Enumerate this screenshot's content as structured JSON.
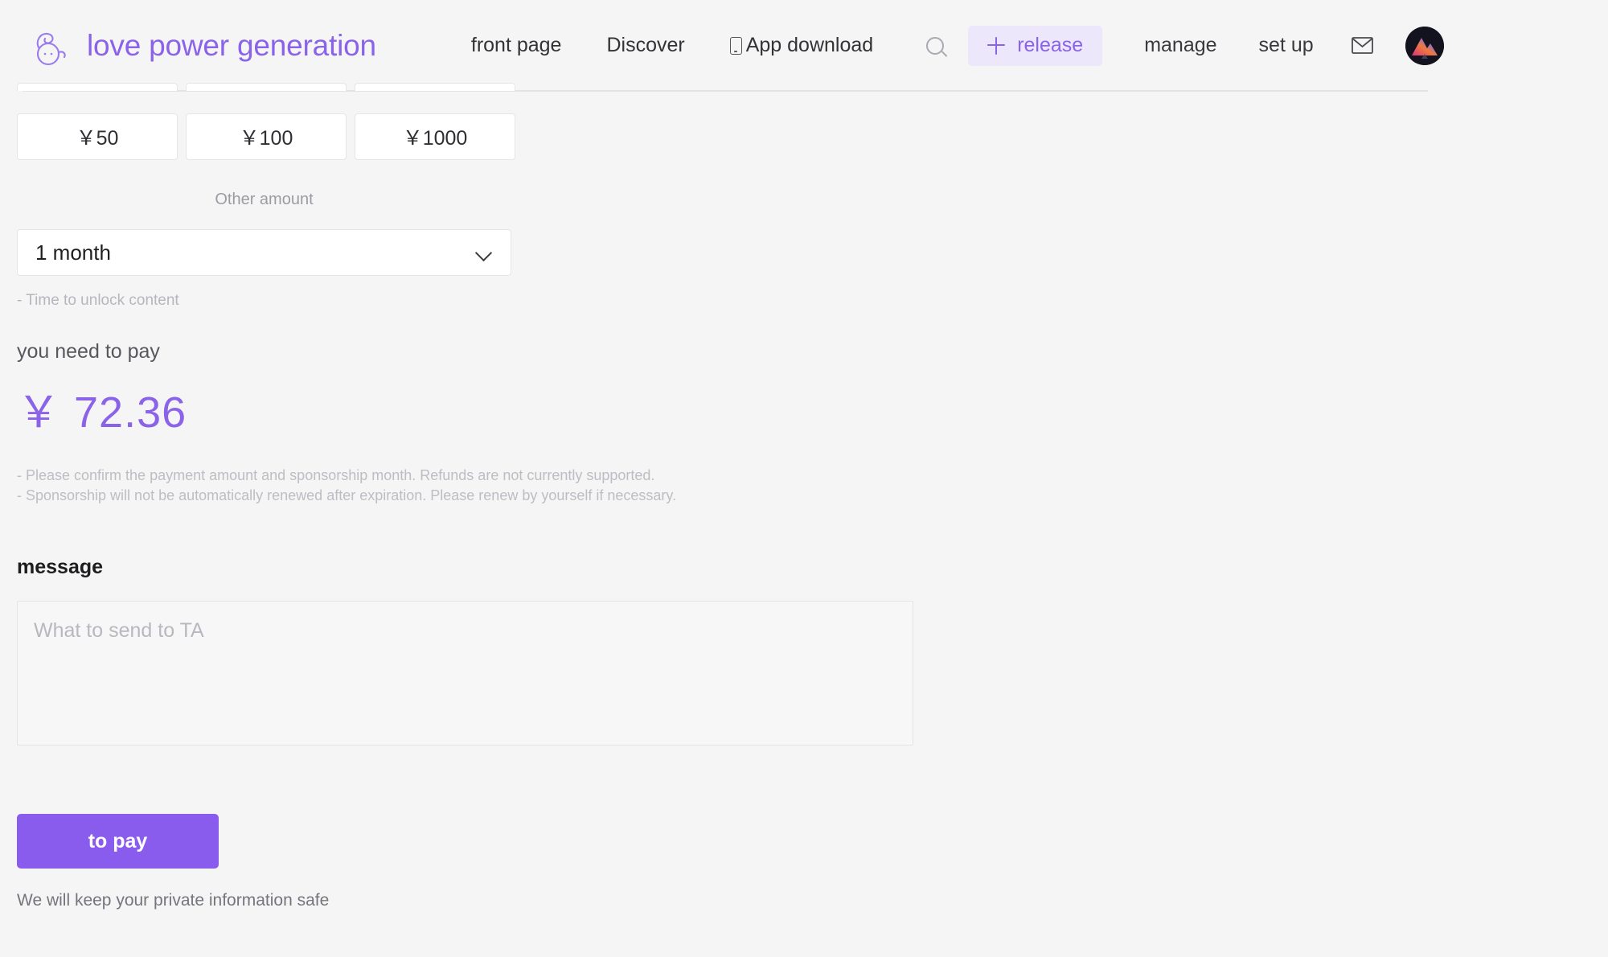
{
  "header": {
    "brand_name": "love power generation",
    "logo_icon": "snail-logo-icon",
    "nav": [
      {
        "label": "front page",
        "icon": null
      },
      {
        "label": "Discover",
        "icon": null
      },
      {
        "label": "App download",
        "icon": "phone-icon"
      }
    ],
    "search_icon": "search-icon",
    "release_label": "release",
    "release_icon": "plus-icon",
    "nav_right": [
      {
        "label": "manage"
      },
      {
        "label": "set up"
      }
    ],
    "mail_icon": "mail-icon",
    "avatar_icon": "user-avatar"
  },
  "sponsor_form": {
    "amount_options": [
      "￥50",
      "￥100",
      "￥1000"
    ],
    "other_amount_placeholder": "Other amount",
    "duration_selected": "1 month",
    "duration_hint": "- Time to unlock content",
    "pay_label": "you need to pay",
    "pay_amount": "￥ 72.36",
    "notes": [
      "- Please confirm the payment amount and sponsorship month. Refunds are not currently supported.",
      "- Sponsorship will not be automatically renewed after expiration. Please renew by yourself if necessary."
    ],
    "message_title": "message",
    "message_placeholder": "What to send to TA",
    "submit_label": "to pay",
    "privacy_note": "We will keep your private information safe"
  },
  "colors": {
    "accent": "#8a63e8",
    "button": "#8a5cee",
    "release_bg": "#ece7fb",
    "page_bg": "#f5f5f6"
  }
}
